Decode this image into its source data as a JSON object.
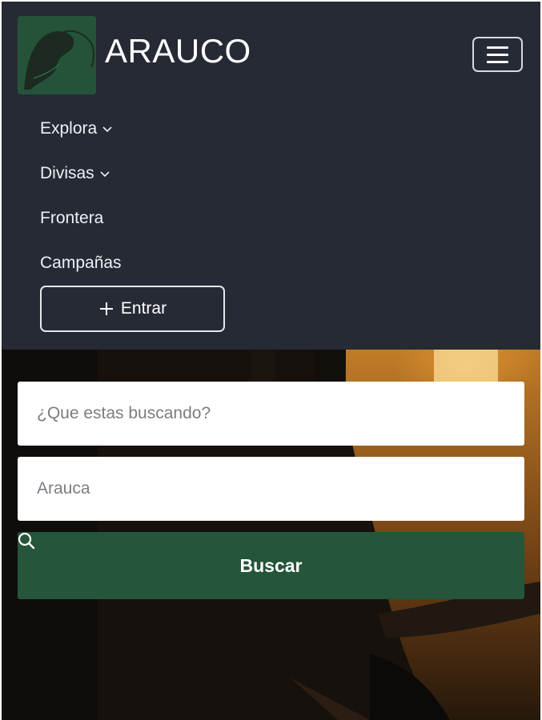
{
  "brand": {
    "name": "ARAUCO",
    "logo_icon": "bird-silhouette-icon",
    "logo_color": "#25533a"
  },
  "nav": {
    "menu_icon": "hamburger-menu-icon",
    "items": [
      {
        "label": "Explora",
        "has_dropdown": true
      },
      {
        "label": "Divisas",
        "has_dropdown": true
      },
      {
        "label": "Frontera",
        "has_dropdown": false
      },
      {
        "label": "Campañas",
        "has_dropdown": false
      }
    ],
    "login_button": {
      "icon": "plus-icon",
      "label": "Entrar"
    }
  },
  "search": {
    "query_placeholder": "¿Que estas buscando?",
    "location_placeholder": "Arauca",
    "submit": {
      "icon": "search-icon",
      "label": "Buscar",
      "color": "#25553a"
    }
  },
  "colors": {
    "navbar_bg": "#262a35",
    "accent": "#25553a"
  }
}
